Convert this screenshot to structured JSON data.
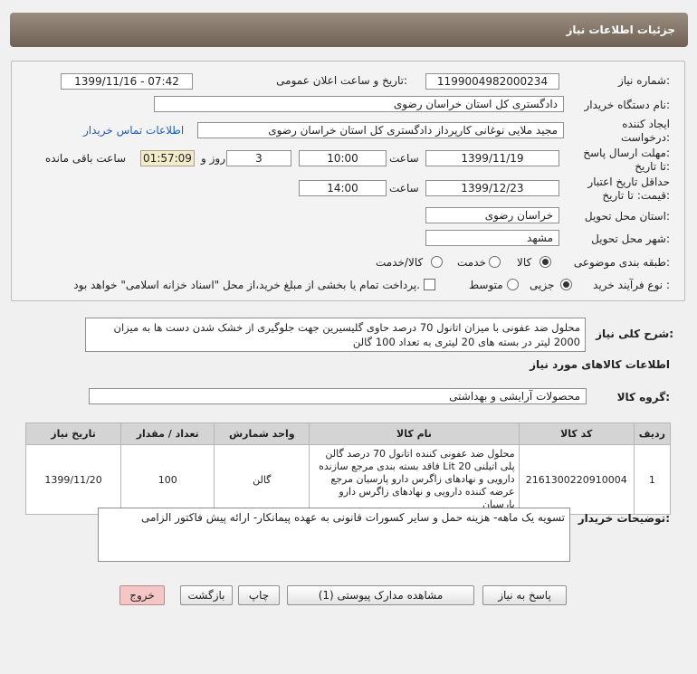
{
  "header": {
    "title": "جزئیات اطلاعات نیاز"
  },
  "need_number": {
    "label": "شماره نیاز:",
    "value": "1199004982000234"
  },
  "announce": {
    "label": "تاریخ و ساعت اعلان عمومی:",
    "value": "1399/11/16 - 07:42"
  },
  "buyer_org": {
    "label": "نام دستگاه خریدار:",
    "value": "دادگستری کل استان خراسان رضوی"
  },
  "requester": {
    "label1": "ایجاد کننده",
    "label2": "درخواست:",
    "value": "مجید ملایی نوغانی کارپرداز دادگستری کل استان خراسان رضوی",
    "contact_link": "اطلاعات تماس خریدار"
  },
  "reply_deadline": {
    "label1": "مهلت ارسال پاسخ:",
    "label2": "تا تاریخ:",
    "date": "1399/11/19",
    "time_label": "ساعت",
    "time": "10:00",
    "days": "3",
    "days_label": "روز و",
    "remaining": "01:57:09",
    "remaining_label": "ساعت باقی مانده"
  },
  "price_validity": {
    "label1": "حداقل تاریخ اعتبار",
    "label2": "قیمت: تا تاریخ:",
    "date": "1399/12/23",
    "time_label": "ساعت",
    "time": "14:00"
  },
  "province": {
    "label": "استان محل تحویل:",
    "value": "خراسان رضوی"
  },
  "city": {
    "label": "شهر محل تحویل:",
    "value": "مشهد"
  },
  "category": {
    "label": "طبقه بندی موضوعی:",
    "options": [
      "کالا",
      "خدمت",
      "کالا/خدمت"
    ],
    "selected": "کالا"
  },
  "process": {
    "label": "نوع فرآیند خرید :",
    "options": [
      "جزیی",
      "متوسط"
    ],
    "selected": "جزیی",
    "treasury_note": "پرداخت تمام یا بخشی از مبلغ خرید،از محل \"اسناد خزانه اسلامی\" خواهد بود."
  },
  "summary": {
    "label": "شرح کلی نیاز:",
    "text": "محلول ضد عفونی با میزان اتانول 70 درصد حاوی گلیسیرین جهت جلوگیری از خشک شدن دست ها به میزان 2000 لیتر در بسته های 20 لیتری به تعداد 100 گالن"
  },
  "goods_info": {
    "title": "اطلاعات کالاهای مورد نیاز"
  },
  "goods_group": {
    "label": "گروه کالا:",
    "value": "محصولات آرایشی و بهداشتی"
  },
  "table": {
    "headers": [
      "ردیف",
      "کد کالا",
      "نام کالا",
      "واحد شمارش",
      "تعداد / مقدار",
      "تاریخ نیاز"
    ],
    "rows": [
      {
        "row": "1",
        "code": "2161300220910004",
        "name": "محلول ضد عفونی کننده اتانول 70 درصد گالن پلی اتیلنی 20 Lit فاقد بسته بندی مرجع سازنده دارویی و نهادهای زاگرس دارو پارسیان مرجع عرضه کننده دارویی و نهادهای زاگرس دارو پارسیان",
        "unit": "گالن",
        "qty": "100",
        "date": "1399/11/20"
      }
    ]
  },
  "buyer_notes": {
    "label": "توضیحات خریدار:",
    "text": "تسویه یک ماهه- هزینه حمل و سایر کسورات قانونی به عهده پیمانکار- ارائه پیش فاکتور الزامی"
  },
  "buttons": {
    "reply": "پاسخ به نیاز",
    "attachments": "مشاهده مدارک پیوستی (1)",
    "print": "چاپ",
    "back": "بازگشت",
    "exit": "خروج"
  },
  "colors": {
    "header_bg": "#7d6f61",
    "link": "#1f5fb8",
    "exit_button": "#f4c6c6"
  }
}
